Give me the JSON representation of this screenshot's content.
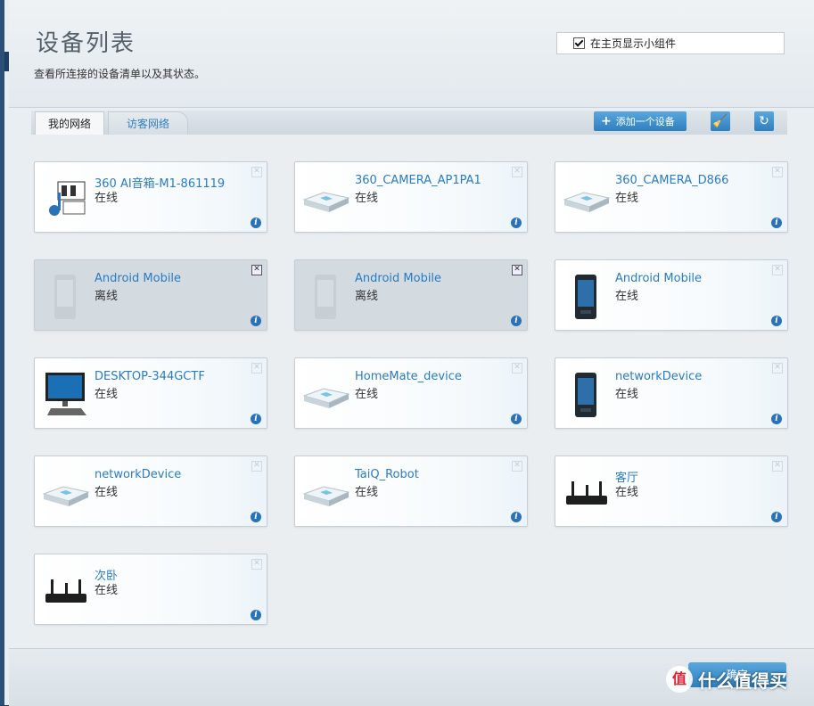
{
  "header": {
    "title": "设备列表",
    "subtitle": "查看所连接的设备清单以及其状态。",
    "widget_label": "在主页显示小组件",
    "widget_checked": true
  },
  "tabs": [
    {
      "label": "我的网络",
      "active": true
    },
    {
      "label": "访客网络",
      "active": false
    }
  ],
  "toolbar": {
    "add_label": "添加一个设备"
  },
  "devices": [
    {
      "name": "360 AI音箱-M1-861119",
      "status": "在线",
      "icon": "media-player-icon",
      "offline": false
    },
    {
      "name": "360_CAMERA_AP1PA1",
      "status": "在线",
      "icon": "network-device-icon",
      "offline": false
    },
    {
      "name": "360_CAMERA_D866",
      "status": "在线",
      "icon": "network-device-icon",
      "offline": false
    },
    {
      "name": "Android Mobile",
      "status": "离线",
      "icon": "mobile-phone-icon",
      "offline": true
    },
    {
      "name": "Android Mobile",
      "status": "离线",
      "icon": "mobile-phone-icon",
      "offline": true
    },
    {
      "name": "Android Mobile",
      "status": "在线",
      "icon": "mobile-phone-icon",
      "offline": false
    },
    {
      "name": "DESKTOP-344GCTF",
      "status": "在线",
      "icon": "desktop-computer-icon",
      "offline": false
    },
    {
      "name": "HomeMate_device",
      "status": "在线",
      "icon": "network-device-icon",
      "offline": false
    },
    {
      "name": "networkDevice",
      "status": "在线",
      "icon": "mobile-phone-icon",
      "offline": false
    },
    {
      "name": "networkDevice",
      "status": "在线",
      "icon": "network-device-icon",
      "offline": false
    },
    {
      "name": "TaiQ_Robot",
      "status": "在线",
      "icon": "network-device-icon",
      "offline": false
    },
    {
      "name": "客厅",
      "status": "在线",
      "icon": "router-icon",
      "offline": false
    },
    {
      "name": "次卧",
      "status": "在线",
      "icon": "router-icon",
      "offline": false
    }
  ],
  "footer": {
    "ok_label": "确定"
  },
  "watermark": {
    "logo_text": "值",
    "text": "什么值得买"
  },
  "colors": {
    "accent": "#2f7fbd",
    "link": "#2a7bbf",
    "offline_card": "#d3dae0"
  }
}
